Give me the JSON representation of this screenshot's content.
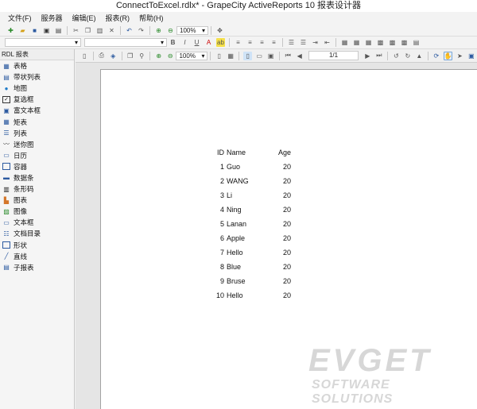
{
  "window": {
    "title": "ConnectToExcel.rdlx* - GrapeCity ActiveReports 10 报表设计器"
  },
  "menu": [
    {
      "label": "文件(F)"
    },
    {
      "label": "服务器"
    },
    {
      "label": "编辑(E)"
    },
    {
      "label": "报表(R)"
    },
    {
      "label": "帮助(H)"
    }
  ],
  "toolbar1": {
    "zoom": "100%"
  },
  "toolbox": {
    "header": "RDL 报表",
    "items": [
      {
        "label": "表格",
        "icon": "table-icon"
      },
      {
        "label": "带状列表",
        "icon": "banded-list-icon"
      },
      {
        "label": "地图",
        "icon": "globe-icon"
      },
      {
        "label": "复选框",
        "icon": "checkbox-icon"
      },
      {
        "label": "富文本框",
        "icon": "richtext-icon"
      },
      {
        "label": "矩表",
        "icon": "matrix-icon"
      },
      {
        "label": "列表",
        "icon": "list-icon"
      },
      {
        "label": "迷你图",
        "icon": "sparkline-icon"
      },
      {
        "label": "日历",
        "icon": "calendar-icon"
      },
      {
        "label": "容器",
        "icon": "container-icon"
      },
      {
        "label": "数据条",
        "icon": "databar-icon"
      },
      {
        "label": "条形码",
        "icon": "barcode-icon"
      },
      {
        "label": "图表",
        "icon": "chart-icon"
      },
      {
        "label": "图像",
        "icon": "image-icon"
      },
      {
        "label": "文本框",
        "icon": "textbox-icon"
      },
      {
        "label": "文档目录",
        "icon": "toc-icon"
      },
      {
        "label": "形状",
        "icon": "shape-icon"
      },
      {
        "label": "直线",
        "icon": "line-icon"
      },
      {
        "label": "子报表",
        "icon": "subreport-icon"
      }
    ]
  },
  "viewer": {
    "zoom": "100%",
    "page": "1/1"
  },
  "report": {
    "headers": {
      "id": "ID",
      "name": "Name",
      "age": "Age"
    },
    "rows": [
      {
        "id": "1",
        "name": "Guo",
        "age": "20"
      },
      {
        "id": "2",
        "name": "WANG",
        "age": "20"
      },
      {
        "id": "3",
        "name": "Li",
        "age": "20"
      },
      {
        "id": "4",
        "name": "Ning",
        "age": "20"
      },
      {
        "id": "5",
        "name": "Lanan",
        "age": "20"
      },
      {
        "id": "6",
        "name": "Apple",
        "age": "20"
      },
      {
        "id": "7",
        "name": "Hello",
        "age": "20"
      },
      {
        "id": "8",
        "name": "Blue",
        "age": "20"
      },
      {
        "id": "9",
        "name": "Bruse",
        "age": "20"
      },
      {
        "id": "10",
        "name": "Hello",
        "age": "20"
      }
    ]
  },
  "watermark": {
    "brand": "EVGET",
    "tagline": "SOFTWARE SOLUTIONS"
  }
}
